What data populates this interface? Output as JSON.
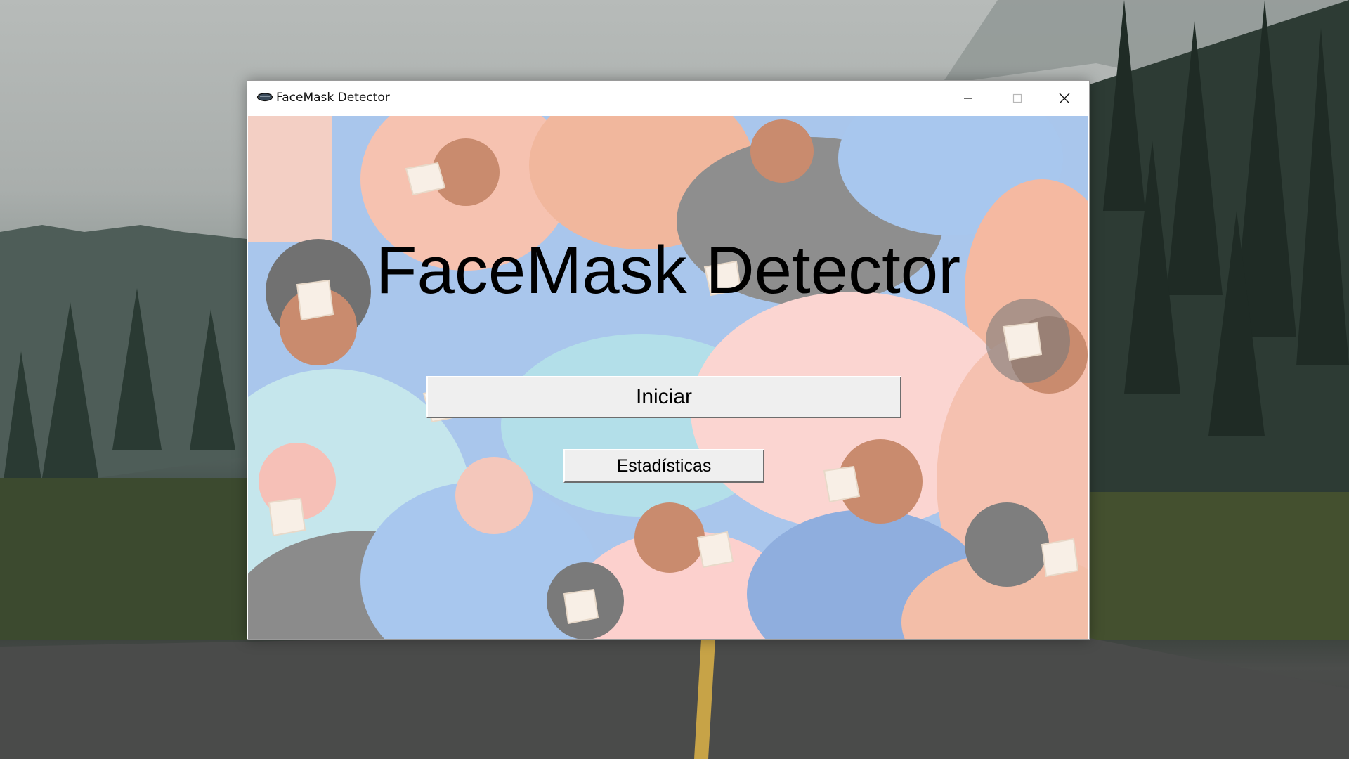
{
  "window": {
    "title": "FaceMask Detector",
    "icon": "face-mask-icon",
    "controls": [
      "minimize-icon",
      "maximize-icon",
      "close-icon"
    ]
  },
  "main": {
    "heading": "FaceMask Detector",
    "start_button_label": "Iniciar",
    "stats_button_label": "Estadísticas"
  },
  "colors": {
    "button_face": "#efefef",
    "title_bar": "#ffffff",
    "heading_text": "#000000"
  }
}
